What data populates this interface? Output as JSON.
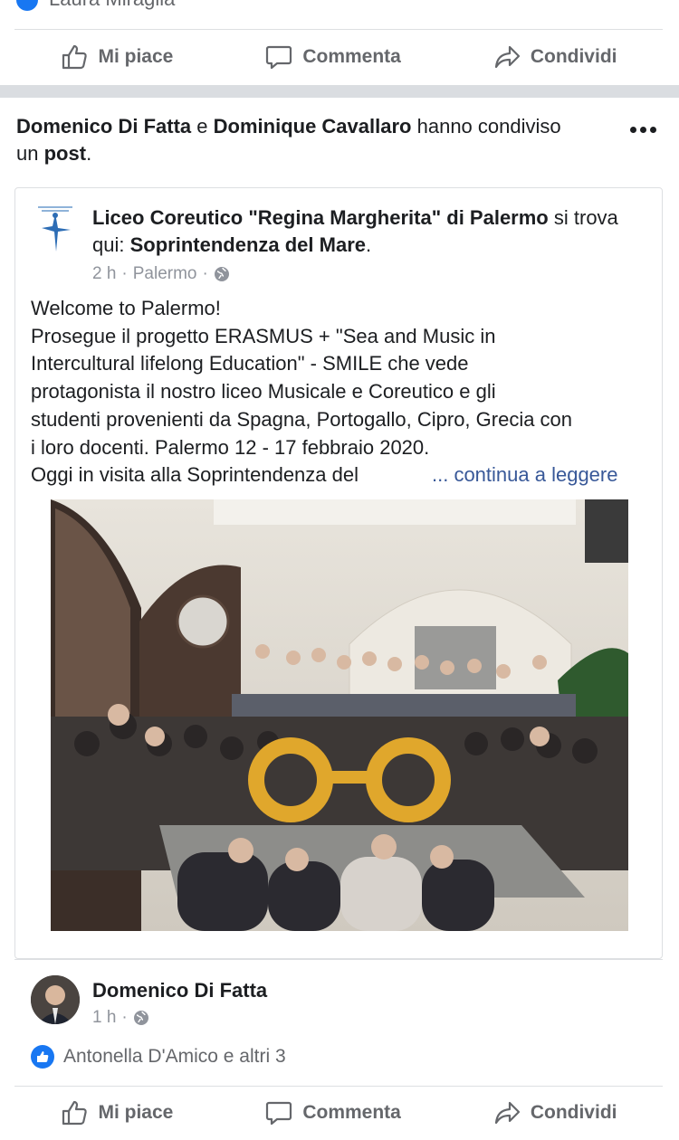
{
  "top_reaction": {
    "name": "Laura Miraglia"
  },
  "actions": {
    "like": "Mi piace",
    "comment": "Commenta",
    "share": "Condividi"
  },
  "share_header": {
    "actor1": "Domenico Di Fatta",
    "conj": "e",
    "actor2": "Dominique Cavallaro",
    "verb": "hanno condiviso",
    "prefix2": "un",
    "object": "post",
    "period": "."
  },
  "post": {
    "page_name": "Liceo Coreutico \"Regina Margherita\" di Palermo",
    "location_verb": "si trova qui:",
    "location": "Soprintendenza del Mare",
    "location_period": ".",
    "time": "2 h",
    "separator": "·",
    "place": "Palermo",
    "text_lines": [
      "Welcome to Palermo!",
      "Prosegue il progetto ERASMUS + \"Sea and Music in",
      "Intercultural lifelong Education\" - SMILE che vede",
      "protagonista il nostro liceo Musicale e Coreutico e gli",
      "studenti provenienti da Spagna, Portogallo, Cipro, Grecia con",
      "i loro docenti. Palermo 12 - 17 febbraio 2020.",
      "Oggi in visita alla Soprintendenza del"
    ],
    "read_more": "... continua a leggere"
  },
  "comment": {
    "name": "Domenico Di Fatta",
    "time": "1 h",
    "separator": "·",
    "reactions_text": "Antonella D'Amico e altri 3"
  },
  "colors": {
    "accent": "#1877f2",
    "link": "#385898",
    "muted": "#65676b",
    "separator": "#dadde1"
  },
  "icons": [
    "like-icon",
    "comment-icon",
    "share-icon",
    "globe-icon",
    "more-icon",
    "page-logo",
    "avatar"
  ]
}
